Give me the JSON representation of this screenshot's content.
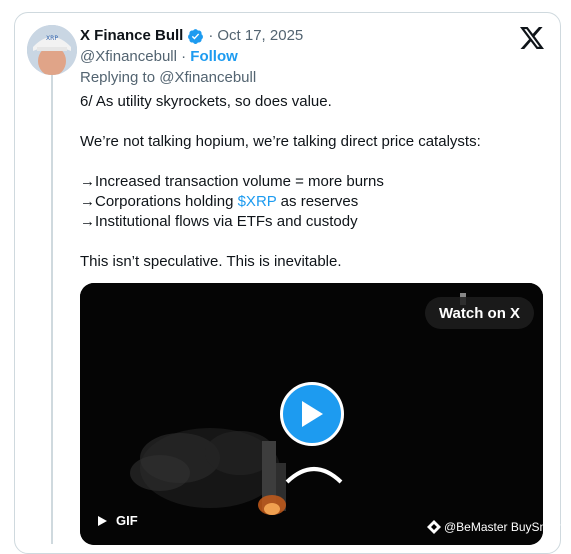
{
  "author": {
    "name": "X Finance Bull",
    "date": "Oct 17, 2025",
    "handle": "@Xfinancebull",
    "follow_label": "Follow",
    "replying_to": "Replying to @Xfinancebull",
    "verified": true
  },
  "tweet": {
    "line1": "6/ As utility skyrockets, so does value.",
    "line2": "We’re not talking hopium, we’re talking direct price catalysts:",
    "line3": "→Increased transaction volume = more burns",
    "line4_pre": "→Corporations holding ",
    "line4_cashtag": "$XRP",
    "line4_post": " as reserves",
    "line5": "→Institutional flows via ETFs and custody",
    "line6": "This isn’t speculative. This is inevitable."
  },
  "media": {
    "watch_label": "Watch on X",
    "gif_label": "GIF",
    "watermark": "@BeMaster BuySmart"
  },
  "icons": {
    "verified": "verified-badge-icon",
    "x_logo": "x-logo-icon",
    "play": "play-icon",
    "gif": "play-small-icon"
  },
  "colors": {
    "accent": "#1d9bf0",
    "text": "#0f1419",
    "muted": "#536471"
  }
}
